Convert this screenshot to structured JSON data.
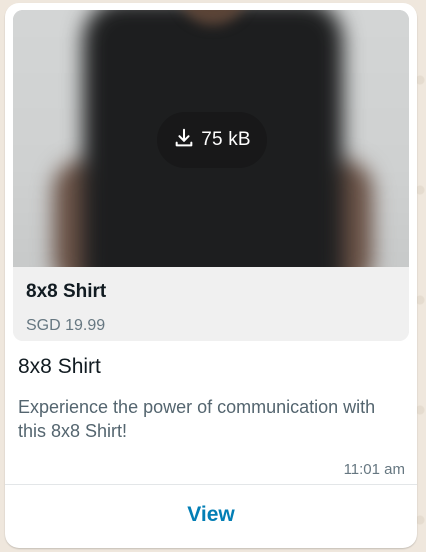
{
  "product": {
    "image_download": {
      "size_label": "75 kB",
      "icon": "download-icon"
    },
    "name": "8x8 Shirt",
    "price": "SGD 19.99"
  },
  "message": {
    "title": "8x8 Shirt",
    "description": "Experience the power of communication with this 8x8 Shirt!",
    "timestamp": "11:01 am"
  },
  "actions": {
    "view_label": "View"
  },
  "colors": {
    "accent": "#027eb5",
    "chat_background": "#efe7dd",
    "bubble": "#ffffff",
    "card": "#f0f0f0"
  }
}
